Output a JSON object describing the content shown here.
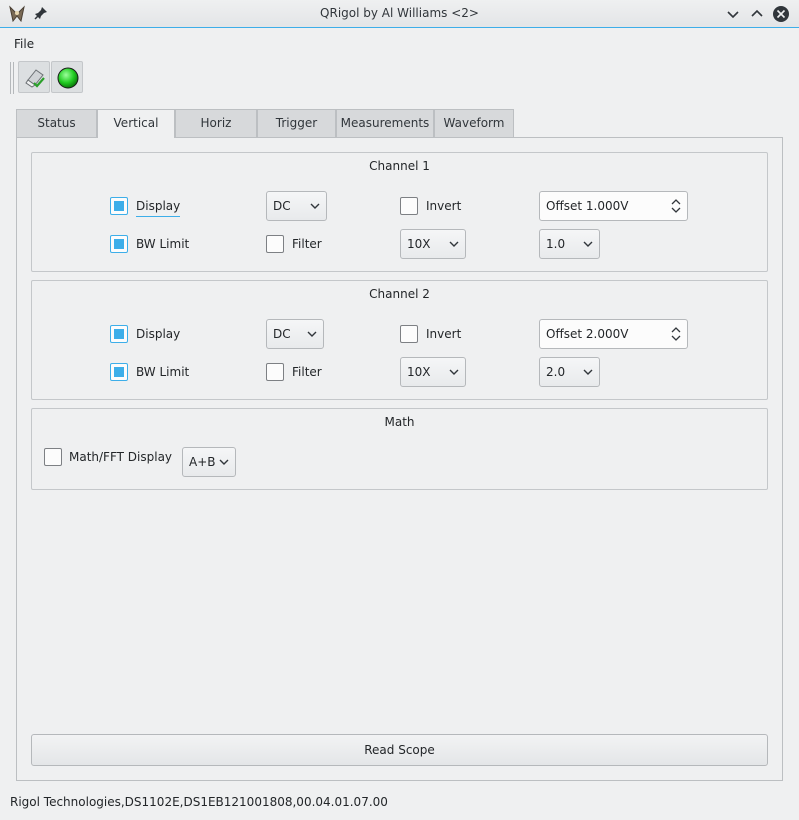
{
  "window": {
    "title": "QRigol by Al Williams <2>",
    "icons": [
      "app-icon",
      "pin-icon",
      "minimize-icon",
      "maximize-icon",
      "close-icon"
    ]
  },
  "menu": {
    "file": "File"
  },
  "toolbar": {
    "buttons": [
      "eraser-check-icon",
      "green-status-led-icon"
    ]
  },
  "tabs": [
    "Status",
    "Vertical",
    "Horiz",
    "Trigger",
    "Measurements",
    "Waveform"
  ],
  "active_tab": "Vertical",
  "channel1": {
    "title": "Channel 1",
    "display_label": "Display",
    "display_checked": true,
    "coupling": "DC",
    "invert_label": "Invert",
    "invert_checked": false,
    "offset": "Offset 1.000V",
    "bwlimit_label": "BW Limit",
    "bwlimit_checked": true,
    "filter_label": "Filter",
    "filter_checked": false,
    "probe": "10X",
    "scale": "1.0"
  },
  "channel2": {
    "title": "Channel 2",
    "display_label": "Display",
    "display_checked": true,
    "coupling": "DC",
    "invert_label": "Invert",
    "invert_checked": false,
    "offset": "Offset 2.000V",
    "bwlimit_label": "BW Limit",
    "bwlimit_checked": true,
    "filter_label": "Filter",
    "filter_checked": false,
    "probe": "10X",
    "scale": "2.0"
  },
  "math": {
    "title": "Math",
    "display_label": "Math/FFT Display",
    "display_checked": false,
    "operation": "A+B"
  },
  "read_button": "Read Scope",
  "status": "Rigol Technologies,DS1102E,DS1EB121001808,00.04.01.07.00",
  "colors": {
    "accent": "#3daee9",
    "background": "#eff0f1",
    "led": "#22cc22"
  }
}
